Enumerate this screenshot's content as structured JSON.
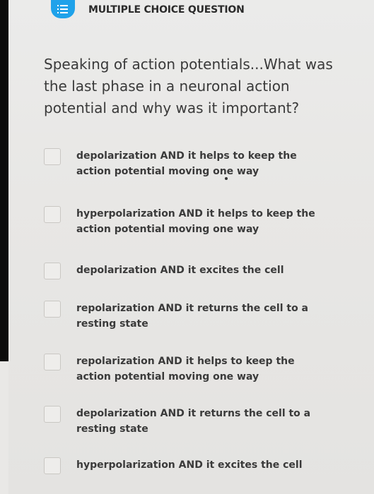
{
  "header": {
    "title": "MULTIPLE CHOICE QUESTION",
    "icon": "list-icon",
    "accent": "#1fa2ea"
  },
  "question": {
    "text": "Speaking of action potentials...What was the last phase in a neuronal action potential and why was it important?"
  },
  "options": [
    {
      "label": "depolarization AND it helps to keep the action potential moving one way"
    },
    {
      "label": "hyperpolarization AND it helps to keep the action potential moving one way"
    },
    {
      "label": "depolarization AND it excites the cell"
    },
    {
      "label": "repolarization AND it returns the cell to a resting state"
    },
    {
      "label": "repolarization AND it helps to keep the action potential moving one way"
    },
    {
      "label": "depolarization AND it returns the cell to a resting state"
    },
    {
      "label": "hyperpolarization AND it excites the cell"
    }
  ]
}
